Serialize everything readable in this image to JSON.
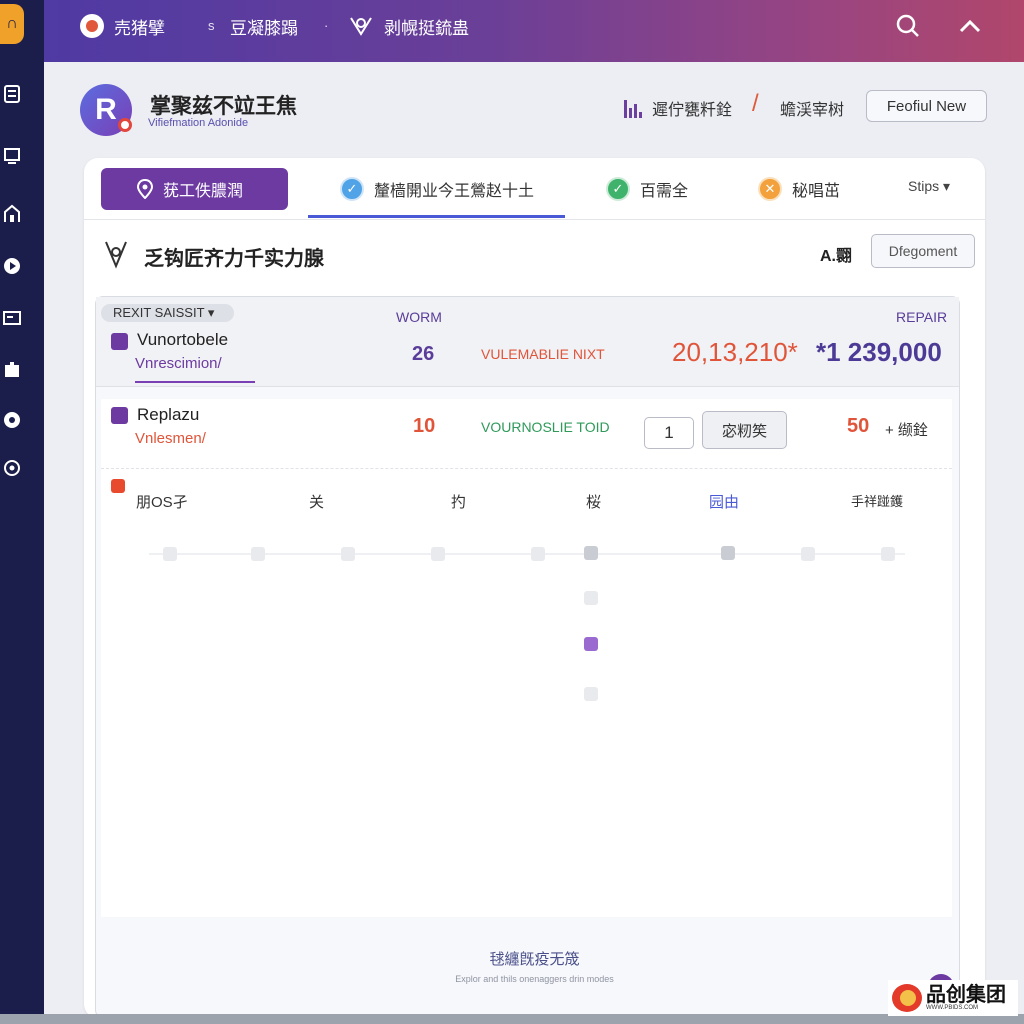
{
  "colors": {
    "accent": "#6c3aa1",
    "rail": "#1b1d4a",
    "orange": "#e0553a",
    "green": "#2f9a5a",
    "tab_blue": "#4a5ad6"
  },
  "topbar": {
    "item1": "売猪擘",
    "sep1": "s",
    "item2": "豆凝膝蹋",
    "sep2": "·",
    "item3": "剥幌挺鋶蛊",
    "icons": [
      "search-icon",
      "chevron-up-icon"
    ]
  },
  "rail": {
    "logo": "∩",
    "icons": [
      "print-icon",
      "monitor-icon",
      "home-icon",
      "play-icon",
      "card-icon",
      "puzzle-icon",
      "circle-icon",
      "settings-icon"
    ]
  },
  "header": {
    "avatar_letter": "R",
    "title": "掌聚兹不竝王焦",
    "subtitle": "Vifiefmation Adonide",
    "stat1": "遲佇甕粁銓",
    "stat2": "蟾渓宰树",
    "button": "Feofiul New"
  },
  "tabs": {
    "primary": "莸工佚膿潤",
    "tab2": "釐樯開业今王鶯赵十土",
    "tab3": "百需全",
    "tab4": "秘唱茁",
    "steps": "Stips ▾"
  },
  "section": {
    "title": "乏钩匠齐力千实力腺",
    "right_label": "A.翾",
    "button": "Dfegoment"
  },
  "table": {
    "pill": "REXIT SAISSIT ▾",
    "col_worm": "WORM",
    "col_repair": "REPAIR",
    "row1": {
      "name": "Vunortobele",
      "sub": "Vnrescimion/",
      "count": "26",
      "status": "VULEMABLIE NIXT",
      "big_left": "20,13,210*",
      "big_right": "*1 239,000"
    },
    "row2": {
      "name": "Replazu",
      "sub": "Vnlesmen/",
      "count": "10",
      "status": "VOURNOSLIE TOID",
      "qty": "1",
      "button": "宓籾笶",
      "value": "50",
      "value_label": "+ 缬銓"
    },
    "columns": [
      "朋OS孑",
      "关",
      "扚",
      "桜",
      "园由",
      "手祥踫鑊"
    ]
  },
  "footer": {
    "title": "毬纏旣疫无筬",
    "sub": "Explor and thils onenaggers drin modes"
  },
  "watermark": {
    "text": "品创集团",
    "url": "WWW.PBIDS.COM"
  }
}
